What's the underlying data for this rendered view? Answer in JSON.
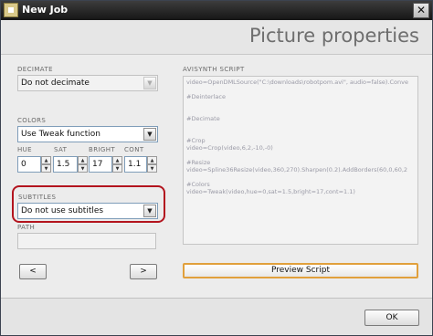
{
  "window": {
    "title": "New Job",
    "close_glyph": "✕"
  },
  "header": {
    "title": "Picture properties"
  },
  "decimate": {
    "label": "DECIMATE",
    "value": "Do not decimate",
    "arrow": "▼"
  },
  "colors": {
    "label": "COLORS",
    "value": "Use Tweak function",
    "arrow": "▼"
  },
  "tweak": {
    "hue": {
      "label": "HUE",
      "value": "0"
    },
    "sat": {
      "label": "SAT",
      "value": "1.5"
    },
    "bright": {
      "label": "BRIGHT",
      "value": "17"
    },
    "cont": {
      "label": "CONT",
      "value": "1.1"
    }
  },
  "spin_glyphs": {
    "up": "▲",
    "down": "▼"
  },
  "subtitles": {
    "label": "SUBTITLES",
    "value": "Do not use subtitles",
    "arrow": "▼"
  },
  "path": {
    "label": "PATH",
    "value": ""
  },
  "nav": {
    "prev": "<",
    "next": ">"
  },
  "avisynth": {
    "label": "AVISYNTH SCRIPT",
    "lines": [
      "video=OpenDMLSource(\"C:\\downloads\\robotpom.avi\", audio=false).Conve",
      "",
      "#Deinterlace",
      "",
      "",
      "#Decimate",
      "",
      "",
      "#Crop",
      "video=Crop(video,6,2,-10,-0)",
      "",
      "#Resize",
      "video=Spline36Resize(video,360,270).Sharpen(0.2).AddBorders(60,0,60,2",
      "",
      "#Colors",
      "video=Tweak(video,hue=0,sat=1.5,bright=17,cont=1.1)"
    ]
  },
  "preview_button": "Preview Script",
  "ok_button": "OK",
  "colors_theme": {
    "highlight": "#b3141e",
    "preview_border": "#e1a03c",
    "title_bar": "#151515"
  }
}
